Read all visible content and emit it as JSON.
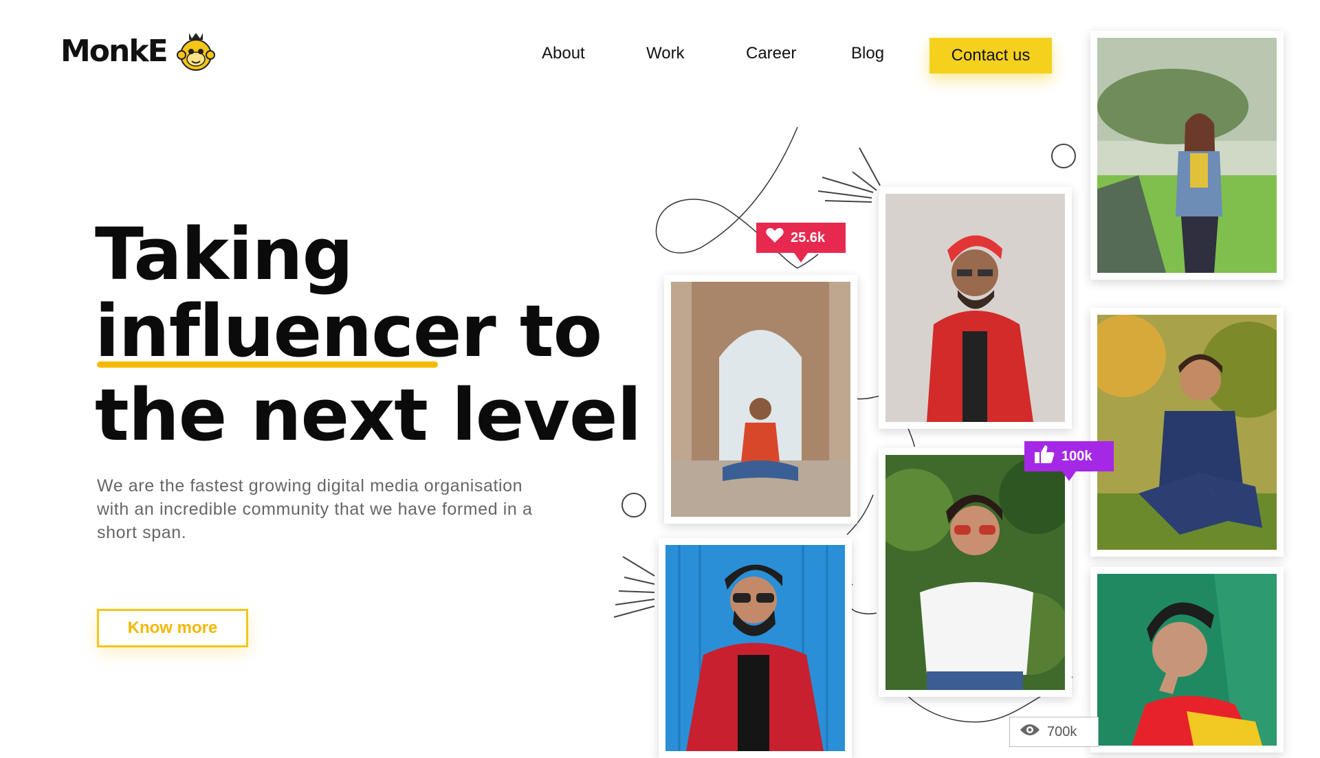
{
  "brand": {
    "name": "MonkE"
  },
  "nav": {
    "items": [
      "About",
      "Work",
      "Career",
      "Blog"
    ],
    "cta": "Contact us"
  },
  "hero": {
    "line1": "Taking",
    "line2a": "influencer",
    "line2b": " to",
    "line3": "the next level",
    "subtitle": "We are the fastest growing digital media organisation with an incredible community that we have formed in a short span.",
    "button": "Know more"
  },
  "stats": {
    "likes": "25.6k",
    "thumbs": "100k",
    "views": "700k"
  },
  "colors": {
    "accent": "#F5D11E",
    "likes_badge": "#E8294F",
    "thumbs_badge": "#A528E6"
  },
  "icons": [
    "monkey-logo-icon",
    "heart-icon",
    "thumbs-up-icon",
    "eye-icon"
  ]
}
